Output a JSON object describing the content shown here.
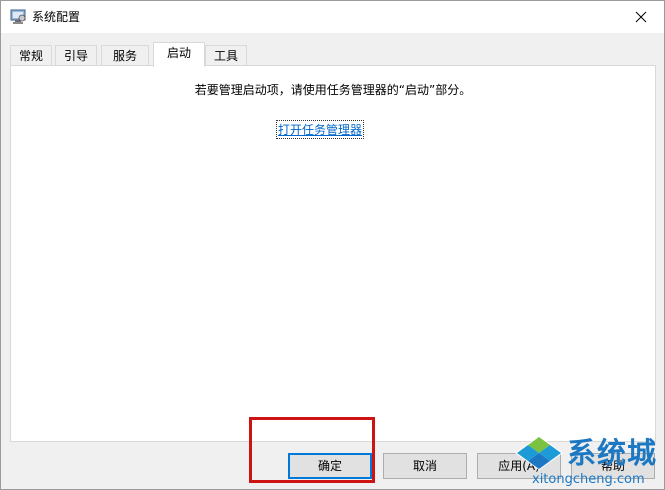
{
  "window": {
    "title": "系统配置"
  },
  "tabs": [
    {
      "label": "常规",
      "active": false
    },
    {
      "label": "引导",
      "active": false
    },
    {
      "label": "服务",
      "active": false
    },
    {
      "label": "启动",
      "active": true
    },
    {
      "label": "工具",
      "active": false
    }
  ],
  "startup": {
    "instruction": "若要管理启动项，请使用任务管理器的“启动”部分。",
    "link_text": "打开任务管理器"
  },
  "buttons": {
    "ok": "确定",
    "cancel": "取消",
    "apply": "应用(A)",
    "help": "帮助"
  },
  "watermark": {
    "brand": "系统城",
    "domain": "xitongcheng.com"
  },
  "colors": {
    "highlight": "#cc1414",
    "link": "#0066cc",
    "watermark": "#1c78c3"
  }
}
